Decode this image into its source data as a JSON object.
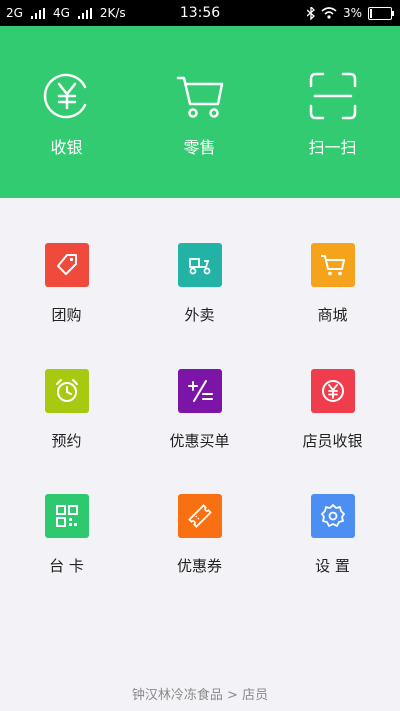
{
  "status_bar": {
    "net1": "2G",
    "net2": "4G",
    "speed": "2K/s",
    "time": "13:56",
    "battery": "3%"
  },
  "colors": {
    "hero_bg": "#33cb72",
    "page_bg": "#f3f3f7",
    "tuangou": "#ef4a3c",
    "waimai": "#23b3a6",
    "shangcheng": "#f5a31a",
    "yuyue": "#a8c911",
    "youhuimaidan": "#7b15a7",
    "dianyuanshouyin": "#ef3d4e",
    "taika": "#2ec86e",
    "youhuiquan": "#f87012",
    "shezhi": "#4d8ef2"
  },
  "hero": [
    {
      "label": "收银",
      "icon": "yuan-circle-icon"
    },
    {
      "label": "零售",
      "icon": "shopping-cart-icon"
    },
    {
      "label": "扫一扫",
      "icon": "scan-frame-icon"
    }
  ],
  "grid": [
    {
      "label": "团购",
      "icon": "tag-icon"
    },
    {
      "label": "外卖",
      "icon": "delivery-scooter-icon"
    },
    {
      "label": "商城",
      "icon": "shopping-cart-icon"
    },
    {
      "label": "预约",
      "icon": "alarm-clock-icon"
    },
    {
      "label": "优惠买单",
      "icon": "discount-icon"
    },
    {
      "label": "店员收银",
      "icon": "yuan-circle-icon"
    },
    {
      "label": "台 卡",
      "icon": "qr-code-icon"
    },
    {
      "label": "优惠券",
      "icon": "coupon-icon"
    },
    {
      "label": "设 置",
      "icon": "gear-icon"
    }
  ],
  "footer": "钟汉林冷冻食品 > 店员"
}
